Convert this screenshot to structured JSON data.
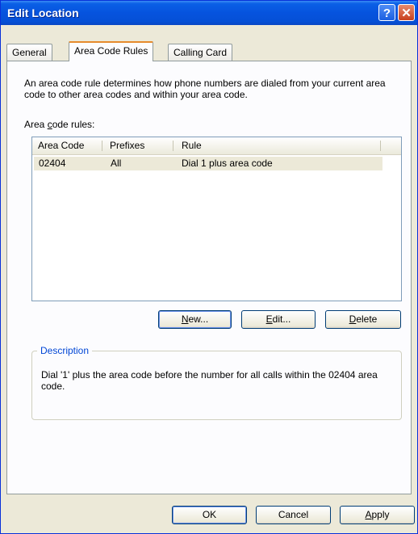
{
  "window": {
    "title": "Edit Location",
    "help_glyph": "?",
    "close_glyph": "✕"
  },
  "tabs": [
    {
      "label": "General"
    },
    {
      "label": "Area Code Rules"
    },
    {
      "label": "Calling Card"
    }
  ],
  "intro_text": "An area code rule determines how phone numbers are dialed from your current area code to other area codes and within your area code.",
  "list_label": {
    "pre": "Area ",
    "mnemonic": "c",
    "post": "ode rules:"
  },
  "list": {
    "columns": [
      "Area Code",
      "Prefixes",
      "Rule"
    ],
    "rows": [
      {
        "area_code": "02404",
        "prefixes": "All",
        "rule": "Dial 1 plus area code"
      }
    ]
  },
  "buttons": {
    "new": {
      "mnemonic": "N",
      "rest": "ew..."
    },
    "edit": {
      "mnemonic": "E",
      "rest": "dit..."
    },
    "delete": {
      "mnemonic": "D",
      "rest": "elete"
    },
    "ok": "OK",
    "cancel": "Cancel",
    "apply": {
      "mnemonic": "A",
      "rest": "pply"
    }
  },
  "description": {
    "title": "Description",
    "text": "Dial '1' plus the area code before the number for all calls within the 02404 area code."
  }
}
